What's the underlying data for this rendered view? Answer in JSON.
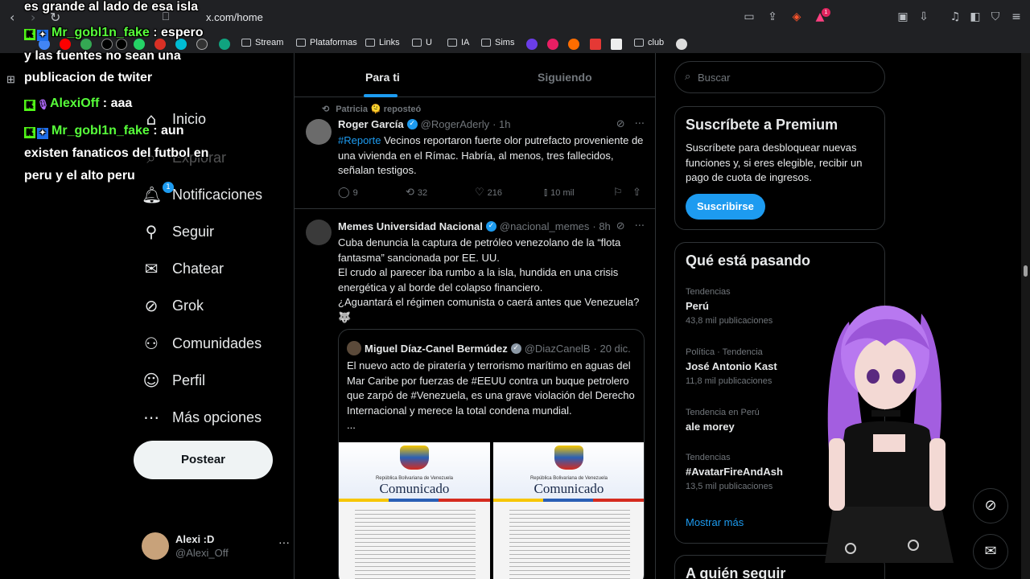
{
  "browser": {
    "url": "x.com/home",
    "bookmarks": [
      "Stream",
      "Plataformas",
      "Links",
      "U",
      "IA",
      "Sims",
      "club"
    ]
  },
  "nav": {
    "items": [
      "Inicio",
      "Explorar",
      "Notificaciones",
      "Seguir",
      "Chatear",
      "Grok",
      "Comunidades",
      "Perfil",
      "Más opciones"
    ],
    "notif_count": "1",
    "post_label": "Postear"
  },
  "account": {
    "name": "Alexi :D",
    "handle": "@Alexi_Off"
  },
  "tabs": {
    "for_you": "Para ti",
    "following": "Siguiendo"
  },
  "tweets": [
    {
      "repost_by": "Patricia 🫠 reposteó",
      "name": "Roger García",
      "handle": "@RogerAderly",
      "time": "· 1h",
      "hashtag": "#Reporte",
      "text": " Vecinos reportaron fuerte olor putrefacto proveniente de una vivienda en el Rímac. Habría, al menos, tres fallecidos, señalan testigos.",
      "replies": "9",
      "reposts": "32",
      "likes": "216",
      "views": "10 mil"
    },
    {
      "name": "Memes Universidad Nacional",
      "handle": "@nacional_memes",
      "time": "· 8h",
      "text1": "Cuba denuncia la captura de petróleo venezolano de la “flota fantasma” sancionada por EE. UU.",
      "text2": "El crudo al parecer iba rumbo a la isla, hundida en una crisis energética y al borde del colapso financiero.",
      "text3": "¿Aguantará el régimen comunista o caerá antes que Venezuela?",
      "emoji": "🐺",
      "quote": {
        "name": "Miguel Díaz-Canel Bermúdez",
        "handle": "@DiazCanelB",
        "time": "· 20 dic.",
        "text": "El nuevo acto de piratería y terrorismo marítimo en aguas del Mar Caribe por fuerzas de #EEUU contra un buque petrolero que zarpó de #Venezuela, es una grave violación del Derecho Internacional y merece la total condena mundial.",
        "ellipsis": "...",
        "doc_header": "República Bolivariana de Venezuela",
        "doc_title": "Comunicado"
      }
    }
  ],
  "right": {
    "search_placeholder": "Buscar",
    "premium": {
      "title": "Suscríbete a Premium",
      "text": "Suscríbete para desbloquear nuevas funciones y, si eres elegible, recibir un pago de cuota de ingresos.",
      "button": "Suscribirse"
    },
    "trends_title": "Qué está pasando",
    "trends": [
      {
        "context": "Tendencias",
        "name": "Perú",
        "count": "43,8 mil publicaciones"
      },
      {
        "context": "Política · Tendencia",
        "name": "José Antonio Kast",
        "count": "11,8 mil publicaciones"
      },
      {
        "context": "Tendencia en Perú",
        "name": "ale morey",
        "count": ""
      },
      {
        "context": "Tendencias",
        "name": "#AvatarFireAndAsh",
        "count": "13,5 mil publicaciones"
      }
    ],
    "show_more": "Mostrar más",
    "who_to_follow": "A quién seguir"
  },
  "chat": [
    {
      "user": "",
      "text": "es grande al lado de esa isla"
    },
    {
      "user": "Mr_gobl1n_fake",
      "text": " : espero"
    },
    {
      "user": "",
      "text": "y las fuentes no sean una"
    },
    {
      "user": "",
      "text": "publicacion de twiter"
    },
    {
      "user": "AlexiOff",
      "text": " : aaa"
    },
    {
      "user": "Mr_gobl1n_fake",
      "text": " : aun"
    },
    {
      "user": "",
      "text": "existen fanaticos del futbol en"
    },
    {
      "user": "",
      "text": "peru y el alto peru"
    }
  ]
}
